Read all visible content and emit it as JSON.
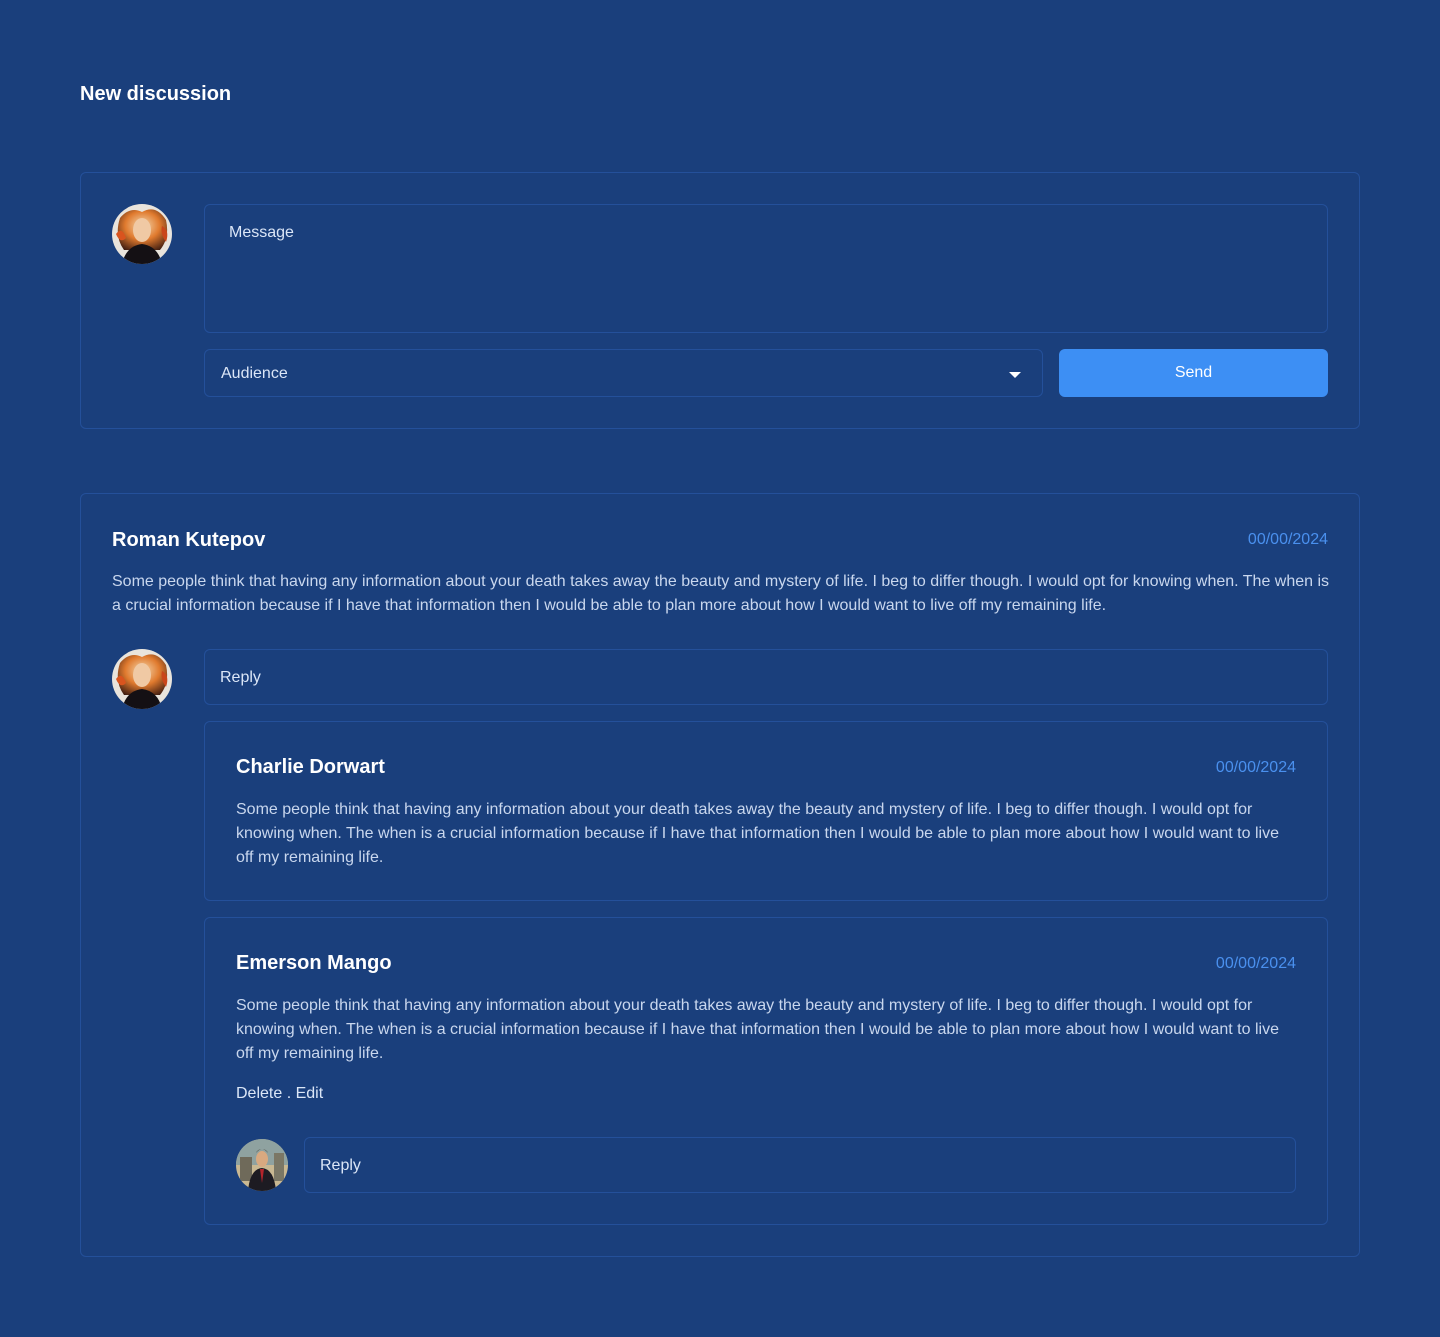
{
  "page": {
    "title": "New discussion"
  },
  "composer": {
    "message_placeholder": "Message",
    "audience_label": "Audience",
    "send_label": "Send"
  },
  "thread": {
    "author": "Roman Kutepov",
    "date": "00/00/2024",
    "body": "Some people think that having any information about your death takes away the beauty and mystery of life. I beg to differ though. I would opt for knowing when. The when is a crucial information because if I have that information then I would be able to plan more about how I would want to live off my remaining life.",
    "reply_placeholder": "Reply",
    "replies": [
      {
        "author": "Charlie Dorwart",
        "date": "00/00/2024",
        "body": "Some people think that having any information about your death takes away the beauty and mystery of life. I beg to differ though. I would opt for knowing when. The when is a crucial information because if I have that information then I would be able to plan more about how I would want to live off my remaining life."
      },
      {
        "author": "Emerson Mango",
        "date": "00/00/2024",
        "body": "Some people think that having any information about your death takes away the beauty and mystery of life. I beg to differ though. I would opt for knowing when. The when is a crucial information because if I have that information then I would be able to plan more about how I would want to live off my remaining life.",
        "delete_label": "Delete",
        "separator": " . ",
        "edit_label": "Edit",
        "reply_placeholder": "Reply"
      }
    ]
  },
  "colors": {
    "background": "#1a3f7c",
    "border": "#24509a",
    "accent": "#3d8ff4",
    "date": "#4a90ee"
  },
  "icons": {
    "audience_dropdown": "chevron-down-icon"
  }
}
